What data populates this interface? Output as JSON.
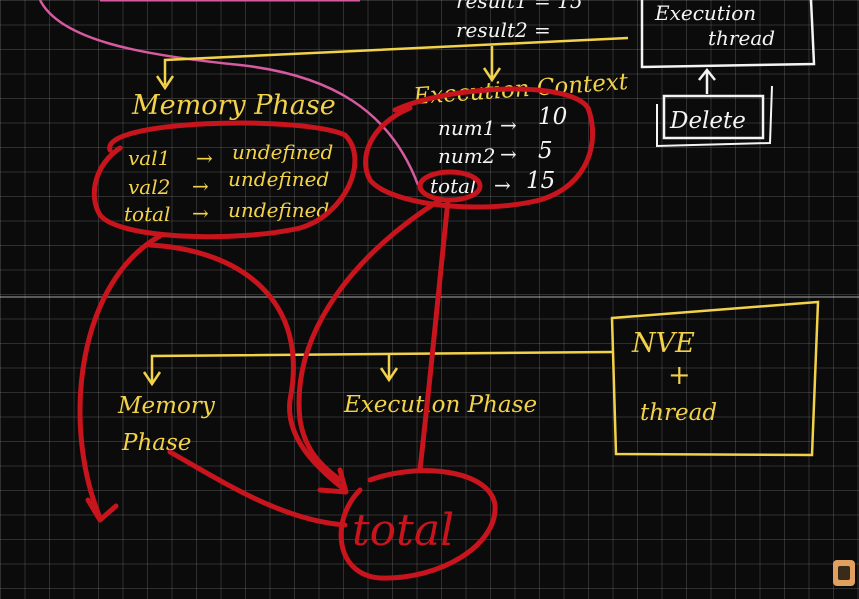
{
  "top": {
    "result_partial": "result1 = 15",
    "result2": "result2 ="
  },
  "execution_thread_box": {
    "line1": "Execution",
    "line2": "thread"
  },
  "delete_box": {
    "label": "Delete"
  },
  "memory_phase_1": {
    "title": "Memory Phase",
    "rows": [
      {
        "name": "val1",
        "arrow": "→",
        "value": "undefined"
      },
      {
        "name": "val2",
        "arrow": "→",
        "value": "undefined"
      },
      {
        "name": "total",
        "arrow": "→",
        "value": "undefined"
      }
    ]
  },
  "execution_context": {
    "title": "Execution Context",
    "rows": [
      {
        "name": "num1",
        "arrow": "→",
        "value": "10"
      },
      {
        "name": "num2",
        "arrow": "→",
        "value": "5"
      },
      {
        "name": "total",
        "arrow": "→",
        "value": "15"
      }
    ]
  },
  "nve_box": {
    "line1": "NVE",
    "line2": "+",
    "line3": "thread"
  },
  "memory_phase_2": {
    "line1": "Memory",
    "line2": "Phase"
  },
  "execution_phase": {
    "title": "Execution Phase"
  },
  "bottom_label": {
    "text": "total"
  },
  "colors": {
    "background": "#0b0b0b",
    "grid": "#8c8c8c",
    "yellow": "#f2d24a",
    "red": "#c8141c",
    "white": "#f4f4f4",
    "pink": "#d65aa0"
  }
}
